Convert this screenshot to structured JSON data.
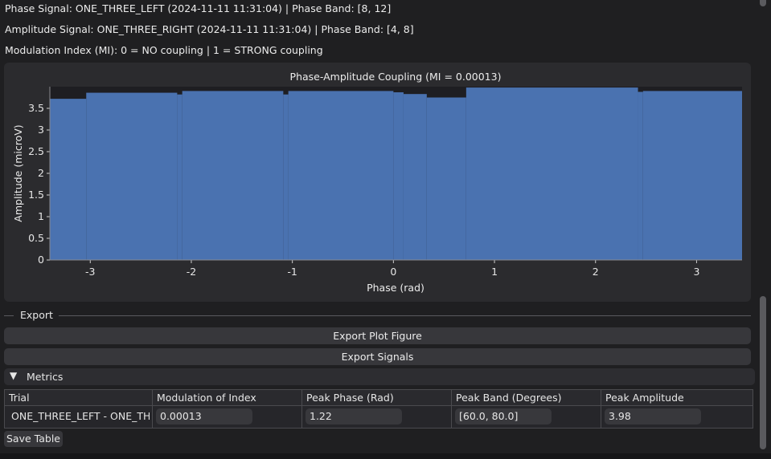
{
  "info": {
    "phase_signal": "Phase Signal: ONE_THREE_LEFT (2024-11-11 11:31:04) | Phase Band: [8, 12]",
    "amplitude_signal": "Amplitude Signal: ONE_THREE_RIGHT (2024-11-11 11:31:04) | Phase Band: [4, 8]",
    "mi_legend": "Modulation Index (MI): 0 = NO coupling | 1 = STRONG coupling"
  },
  "chart_data": {
    "type": "bar",
    "title": "Phase-Amplitude Coupling (MI = 0.00013)",
    "xlabel": "Phase (rad)",
    "ylabel": "Amplitude (microV)",
    "xlim": [
      -3.4,
      3.45
    ],
    "ylim": [
      0,
      4.0
    ],
    "xticks": [
      -3,
      -2,
      -1,
      0,
      1,
      2,
      3
    ],
    "yticks": [
      0,
      0.5,
      1,
      1.5,
      2,
      2.5,
      3,
      3.5
    ],
    "bar_color": "#4a72b0",
    "bin_edges": [
      -3.4,
      -3.04,
      -2.14,
      -2.09,
      -1.09,
      -1.04,
      0.0,
      0.1,
      0.33,
      0.72,
      2.42,
      2.47,
      3.45
    ],
    "values": [
      3.72,
      3.86,
      3.82,
      3.9,
      3.82,
      3.9,
      3.87,
      3.83,
      3.75,
      3.98,
      3.88,
      3.9
    ],
    "grid": false
  },
  "export": {
    "title": "Export",
    "plot_button": "Export Plot Figure",
    "signals_button": "Export Signals"
  },
  "metrics": {
    "title": "Metrics",
    "columns": [
      "Trial",
      "Modulation of Index",
      "Peak Phase (Rad)",
      "Peak Band (Degrees)",
      "Peak Amplitude"
    ],
    "row": [
      "ONE_THREE_LEFT - ONE_THREE_RIGHT",
      "0.00013",
      "1.22",
      "[60.0, 80.0]",
      "3.98"
    ],
    "save_button": "Save Table"
  }
}
